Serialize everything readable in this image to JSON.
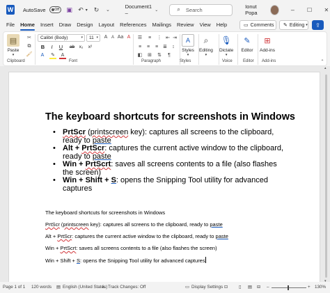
{
  "titlebar": {
    "app_icon_letter": "W",
    "autosave_label": "AutoSave",
    "autosave_state": "Off",
    "doc_title": "Document1",
    "doc_title_sep": "–",
    "search_placeholder": "Search",
    "user_name": "Ionut Popa",
    "minimize": "–",
    "maximize": "☐",
    "close": "✕"
  },
  "tabs": [
    {
      "label": "File",
      "active": false
    },
    {
      "label": "Home",
      "active": true
    },
    {
      "label": "Insert",
      "active": false
    },
    {
      "label": "Draw",
      "active": false
    },
    {
      "label": "Design",
      "active": false
    },
    {
      "label": "Layout",
      "active": false
    },
    {
      "label": "References",
      "active": false
    },
    {
      "label": "Mailings",
      "active": false
    },
    {
      "label": "Review",
      "active": false
    },
    {
      "label": "View",
      "active": false
    },
    {
      "label": "Help",
      "active": false
    }
  ],
  "tab_actions": {
    "comments_label": "Comments",
    "editing_label": "Editing"
  },
  "ribbon": {
    "paste_label": "Paste",
    "font_name": "Calibri (Body)",
    "font_size": "11",
    "styles_label": "Styles",
    "editing_label": "Editing",
    "dictate_label": "Dictate",
    "editor_label": "Editor",
    "addins_label": "Add-ins",
    "group_labels": {
      "clipboard": "Clipboard",
      "font": "Font",
      "paragraph": "Paragraph",
      "styles": "Styles",
      "voice": "Voice",
      "editor": "Editor",
      "addins": "Add-ins"
    },
    "format_buttons": [
      "B",
      "I",
      "U",
      "ab",
      "x₂",
      "x²"
    ],
    "colors": {
      "accent": "#185abd",
      "highlight": "#ffeb3b",
      "font_color": "#d13438"
    }
  },
  "document": {
    "heading": "The keyboard shortcuts for screenshots in Windows",
    "bullets": [
      {
        "key": "PrtScr",
        "rest_pre": " (",
        "squig": "printscreen",
        "rest_post": " key): captures all screens to the clipboard, ready to ",
        "link": "paste"
      },
      {
        "key": "Alt + ",
        "key2": "PrtScr",
        "rest": ": captures the current active window to the clipboard, ready to ",
        "link": "paste"
      },
      {
        "key": "Win + ",
        "key2": "PrtScrt",
        "rest": ": saves all screens contents to a file (also flashes the screen)"
      },
      {
        "key": "Win + Shift + ",
        "key2": "S",
        "rest": ": opens the Snipping Tool utility for advanced captures"
      }
    ],
    "plain_lines": [
      {
        "pre": "The keyboard shortcuts for screenshots in Windows"
      },
      {
        "squig1": "PrtScr",
        "mid1": " (",
        "squig2": "printscreen",
        "mid2": " key): captures all screens to the clipboard, ready to ",
        "link": "paste"
      },
      {
        "pre": "Alt + ",
        "squig1": "PrtScr",
        "mid1": ": captures the current active window to the clipboard, ready to ",
        "link": "paste"
      },
      {
        "pre": "Win + ",
        "squig1": "PrtScrt",
        "mid1": ": saves all screens contents to a file (also flashes the screen)"
      },
      {
        "pre": "Win + Shift + ",
        "squig1": "S",
        "mid1": ": opens the Snipping Tool utility for advanced captures"
      }
    ]
  },
  "statusbar": {
    "page": "Page 1 of 1",
    "words": "120 words",
    "language": "English (United States)",
    "track_changes": "Track Changes: Off",
    "display_settings": "Display Settings",
    "zoom": "130%",
    "zoom_out": "–",
    "zoom_in": "+"
  }
}
